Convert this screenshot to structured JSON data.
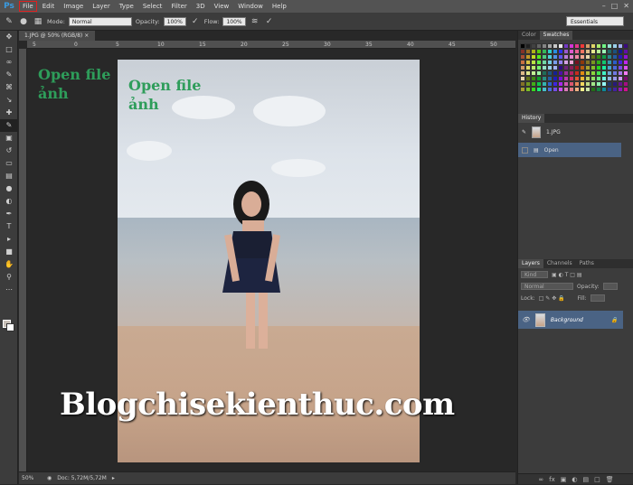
{
  "menu": {
    "logo": "Ps",
    "items": [
      "File",
      "Edit",
      "Image",
      "Layer",
      "Type",
      "Select",
      "Filter",
      "3D",
      "View",
      "Window",
      "Help"
    ]
  },
  "options": {
    "mode_label": "Mode:",
    "mode_value": "Normal",
    "opacity_label": "Opacity:",
    "opacity_value": "100%",
    "flow_label": "Flow:",
    "flow_value": "100%",
    "workspace": "Essentials"
  },
  "document": {
    "tab_title": "1.JPG @ 50% (RGB/8)",
    "overlay_title_line1": "Open file",
    "overlay_title_line2": "ảnh",
    "watermark": "Blogchisekienthuc.com"
  },
  "ruler": {
    "h_ticks": [
      "5",
      "0",
      "5",
      "10",
      "15",
      "20",
      "25",
      "30",
      "35",
      "40",
      "45",
      "50"
    ]
  },
  "status": {
    "zoom": "50%",
    "doc": "Doc: 5,72M/5,72M"
  },
  "color_panel": {
    "tabs": [
      "Color",
      "Swatches"
    ]
  },
  "history": {
    "title": "History",
    "snapshot": "1.JPG",
    "step": "Open"
  },
  "layers": {
    "tabs": [
      "Layers",
      "Channels",
      "Paths"
    ],
    "kind_label": "Kind",
    "blend_mode": "Normal",
    "opacity_label": "Opacity:",
    "lock_label": "Lock:",
    "fill_label": "Fill:",
    "layer_name": "Background"
  }
}
